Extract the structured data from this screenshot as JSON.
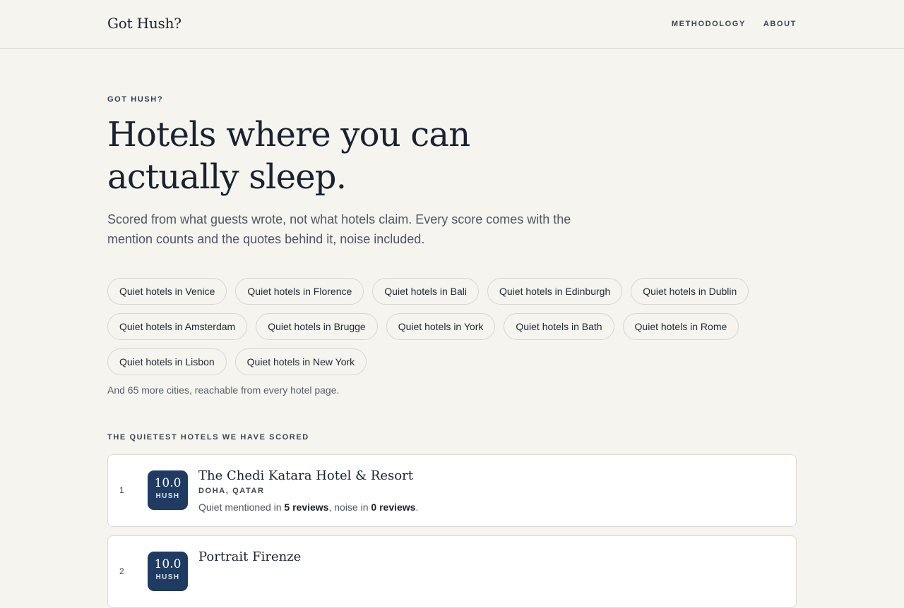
{
  "header": {
    "brand": "Got Hush?",
    "nav": [
      "METHODOLOGY",
      "ABOUT"
    ]
  },
  "hero": {
    "eyebrow": "GOT HUSH?",
    "headline": "Hotels where you can actually sleep.",
    "lede": "Scored from what guests wrote, not what hotels claim. Every score comes with the mention counts and the quotes behind it, noise included."
  },
  "cities": [
    "Quiet hotels in Venice",
    "Quiet hotels in Florence",
    "Quiet hotels in Bali",
    "Quiet hotels in Edinburgh",
    "Quiet hotels in Dublin",
    "Quiet hotels in Amsterdam",
    "Quiet hotels in Brugge",
    "Quiet hotels in York",
    "Quiet hotels in Bath",
    "Quiet hotels in Rome",
    "Quiet hotels in Lisbon",
    "Quiet hotels in New York"
  ],
  "more_cities": "And 65 more cities, reachable from every hotel page.",
  "section_title": "THE QUIETEST HOTELS WE HAVE SCORED",
  "hotels": [
    {
      "rank": "1",
      "score": "10.0",
      "score_label": "HUSH",
      "name": "The Chedi Katara Hotel & Resort",
      "location": "DOHA, QATAR",
      "quiet_prefix": "Quiet mentioned in ",
      "quiet_count": "5 reviews",
      "noise_prefix": ", noise in ",
      "noise_count": "0 reviews",
      "suffix": "."
    },
    {
      "rank": "2",
      "score": "10.0",
      "score_label": "HUSH",
      "name": "Portrait Firenze"
    }
  ],
  "colors": {
    "background": "#f5f4ef",
    "score_badge": "#1f3b61",
    "text": "#1b2330"
  }
}
